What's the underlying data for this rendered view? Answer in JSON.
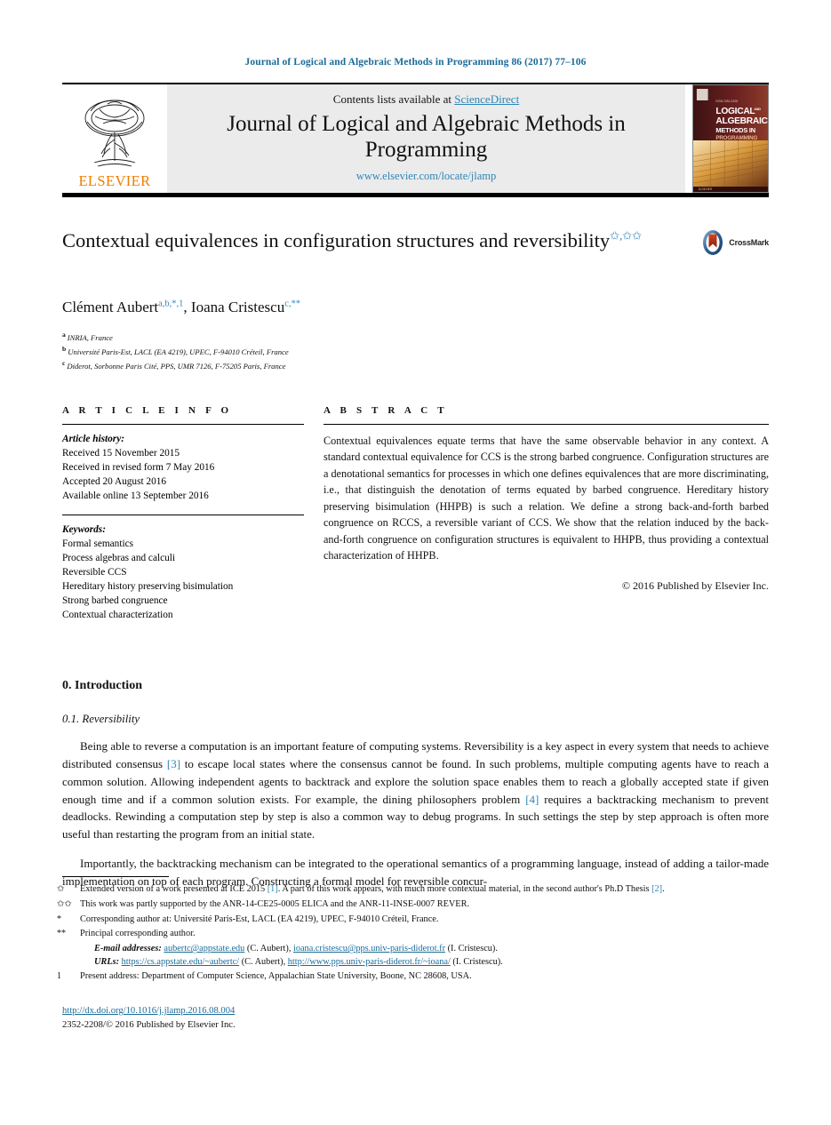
{
  "running_head": "Journal of Logical and Algebraic Methods in Programming 86 (2017) 77–106",
  "masthead": {
    "publisher": "ELSEVIER",
    "contents_prefix": "Contents lists available at ",
    "contents_link": "ScienceDirect",
    "journal_name": "Journal of Logical and Algebraic Methods in Programming",
    "journal_url": "www.elsevier.com/locate/jlamp",
    "cover": {
      "line1": "LOGICAL",
      "line1_small": "AND",
      "line2": "ALGEBRAIC",
      "line3": "METHODS IN",
      "line4": "PROGRAMMING",
      "top_tag": "ISSN 2352-2208",
      "bottom_tag": "ELSEVIER"
    }
  },
  "title": {
    "text": "Contextual equivalences in configuration structures and reversibility",
    "footnote_marks": "✩,✩✩",
    "crossmark_label": "CrossMark"
  },
  "authors": {
    "line": "Clément Aubert",
    "author1": "Clément Aubert",
    "author1_sup": "a,b,*,1",
    "separator": ", ",
    "author2": "Ioana Cristescu",
    "author2_sup": "c,**"
  },
  "affiliations": [
    {
      "letter": "a",
      "text": "INRIA, France"
    },
    {
      "letter": "b",
      "text": "Université Paris-Est, LACL (EA 4219), UPEC, F-94010 Créteil, France"
    },
    {
      "letter": "c",
      "text": "Diderot, Sorbonne Paris Cité, PPS, UMR 7126, F-75205 Paris, France"
    }
  ],
  "article_info": {
    "heading": "A R T I C L E    I N F O",
    "history_label": "Article history:",
    "history": [
      "Received 15 November 2015",
      "Received in revised form 7 May 2016",
      "Accepted 20 August 2016",
      "Available online 13 September 2016"
    ],
    "keywords_label": "Keywords:",
    "keywords": [
      "Formal semantics",
      "Process algebras and calculi",
      "Reversible CCS",
      "Hereditary history preserving bisimulation",
      "Strong barbed congruence",
      "Contextual characterization"
    ]
  },
  "abstract": {
    "heading": "A B S T R A C T",
    "text": "Contextual equivalences equate terms that have the same observable behavior in any context. A standard contextual equivalence for CCS is the strong barbed congruence. Configuration structures are a denotational semantics for processes in which one defines equivalences that are more discriminating, i.e., that distinguish the denotation of terms equated by barbed congruence. Hereditary history preserving bisimulation (HHPB) is such a relation. We define a strong back-and-forth barbed congruence on RCCS, a reversible variant of CCS. We show that the relation induced by the back-and-forth congruence on configuration structures is equivalent to HHPB, thus providing a contextual characterization of HHPB.",
    "copyright": "© 2016 Published by Elsevier Inc."
  },
  "body": {
    "section_heading": "0. Introduction",
    "subsection_heading": "0.1. Reversibility",
    "paragraph1_a": "Being able to reverse a computation is an important feature of computing systems. Reversibility is a key aspect in every system that needs to achieve distributed consensus ",
    "paragraph1_cite1": "[3]",
    "paragraph1_b": " to escape local states where the consensus cannot be found. In such problems, multiple computing agents have to reach a common solution. Allowing independent agents to backtrack and explore the solution space enables them to reach a globally accepted state if given enough time and if a common solution exists. For example, the dining philosophers problem ",
    "paragraph1_cite2": "[4]",
    "paragraph1_c": " requires a backtracking mechanism to prevent deadlocks. Rewinding a computation step by step is also a common way to debug programs. In such settings the step by step approach is often more useful than restarting the program from an initial state.",
    "paragraph2": "Importantly, the backtracking mechanism can be integrated to the operational semantics of a programming language, instead of adding a tailor-made implementation on top of each program. Constructing a formal model for reversible concur-"
  },
  "footnotes": {
    "star_sym": "✩",
    "star_a": "Extended version of a work presented at ICE 2015 ",
    "star_cite1": "[1]",
    "star_b": ". A part of this work appears, with much more contextual material, in the second author's Ph.D Thesis ",
    "star_cite2": "[2]",
    "star_c": ".",
    "starstar_sym": "✩✩",
    "starstar_text": "This work was partly supported by the ANR-14-CE25-0005 ELICA and the ANR-11-INSE-0007 REVER.",
    "corr_sym": "*",
    "corr_text": "Corresponding author at: Université Paris-Est, LACL (EA 4219), UPEC, F-94010 Créteil, France.",
    "princ_sym": "**",
    "princ_text": "Principal corresponding author.",
    "email_label": "E-mail addresses:",
    "email1": "aubertc@appstate.edu",
    "email1_who": " (C. Aubert), ",
    "email2": "ioana.cristescu@pps.univ-paris-diderot.fr",
    "email2_who": " (I. Cristescu).",
    "urls_label": "URLs:",
    "url1": "https://cs.appstate.edu/~aubertc/",
    "url1_who": " (C. Aubert), ",
    "url2": "http://www.pps.univ-paris-diderot.fr/~ioana/",
    "url2_who": " (I. Cristescu).",
    "num1_sym": "1",
    "num1_text": "Present address: Department of Computer Science, Appalachian State University, Boone, NC 28608, USA."
  },
  "bottom": {
    "doi": "http://dx.doi.org/10.1016/j.jlamp.2016.08.004",
    "issn_line": "2352-2208/© 2016 Published by Elsevier Inc."
  },
  "colors": {
    "link": "#1a6b99",
    "accent": "#2e86b8",
    "elsevier_orange": "#f07d00",
    "masthead_bg": "#ebebeb"
  }
}
